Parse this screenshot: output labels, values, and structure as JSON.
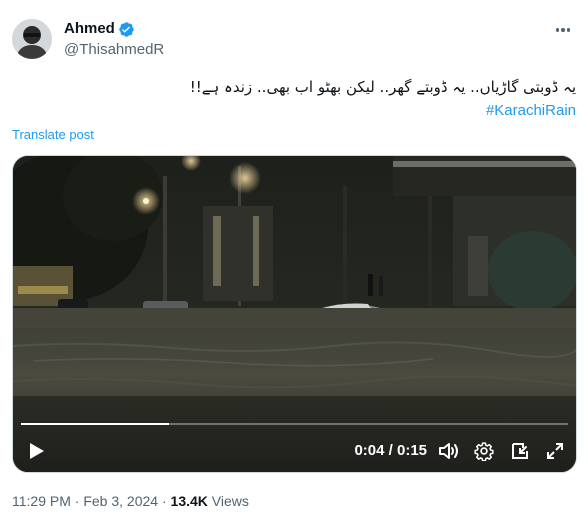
{
  "author": {
    "display_name": "Ahmed",
    "handle": "@ThisahmedR",
    "verified": true
  },
  "post": {
    "text": "یہ ڈوبتی گاڑیاں.. یہ ڈوبتے گھر.. لیکن بھٹو اب بھی.. زندہ ہے!!",
    "hashtag": "#KarachiRain",
    "translate_label": "Translate post"
  },
  "video": {
    "current_time": "0:04",
    "duration": "0:15",
    "time_display": "0:04 / 0:15",
    "progress": 0.27
  },
  "meta": {
    "time": "11:29 PM",
    "date": "Feb 3, 2024",
    "views_count": "13.4K",
    "views_label": "Views"
  },
  "icons": {
    "verified": "verified-badge-icon",
    "more": "more-options-icon",
    "play": "play-icon",
    "volume": "volume-icon",
    "settings": "settings-gear-icon",
    "pip": "picture-in-picture-icon",
    "fullscreen": "fullscreen-icon"
  },
  "colors": {
    "accent": "#1d9bf0",
    "secondary_text": "#536471",
    "primary_text": "#0f1419"
  }
}
